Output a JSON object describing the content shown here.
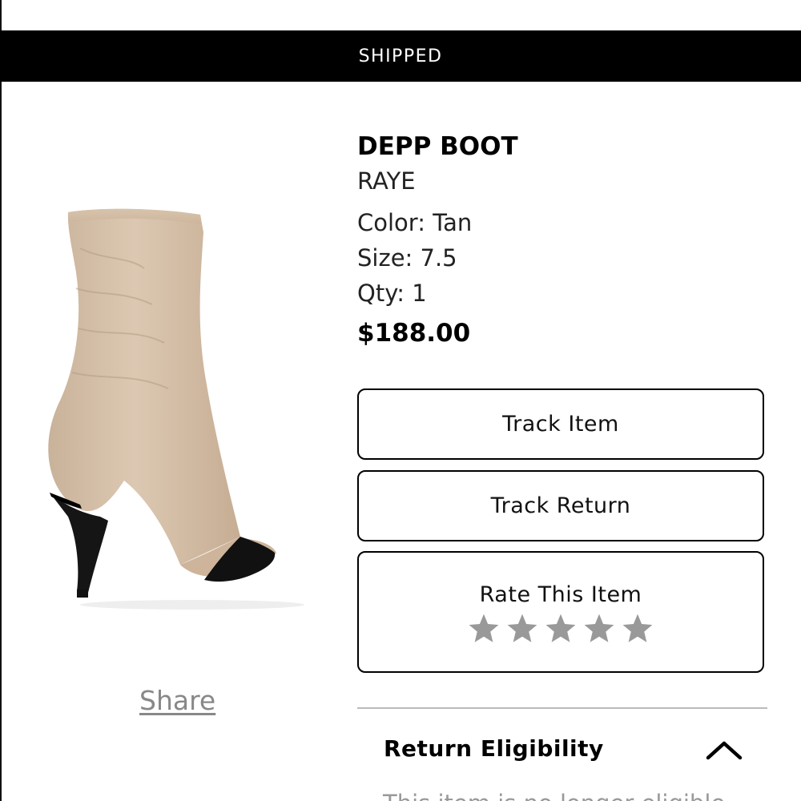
{
  "status": {
    "label": "SHIPPED"
  },
  "product": {
    "name": "DEPP BOOT",
    "brand": "RAYE",
    "color_label": "Color: Tan",
    "size_label": "Size: 7.5",
    "qty_label": "Qty: 1",
    "price": "$188.00",
    "image_icon": "tan-suede-heeled-boot"
  },
  "actions": {
    "share": "Share",
    "track_item": "Track Item",
    "track_return": "Track Return",
    "rate_item": "Rate This Item",
    "rating": {
      "value": 0,
      "max": 5,
      "empty_color": "#999999"
    }
  },
  "return_eligibility": {
    "title": "Return Eligibility",
    "toggle_icon": "chevron-up-icon",
    "expanded": true,
    "text_partial": "This item is no longer eligible"
  },
  "colors": {
    "status_bar_bg": "#000000",
    "status_bar_text": "#ffffff",
    "share_link": "#888888",
    "button_border": "#000000"
  }
}
